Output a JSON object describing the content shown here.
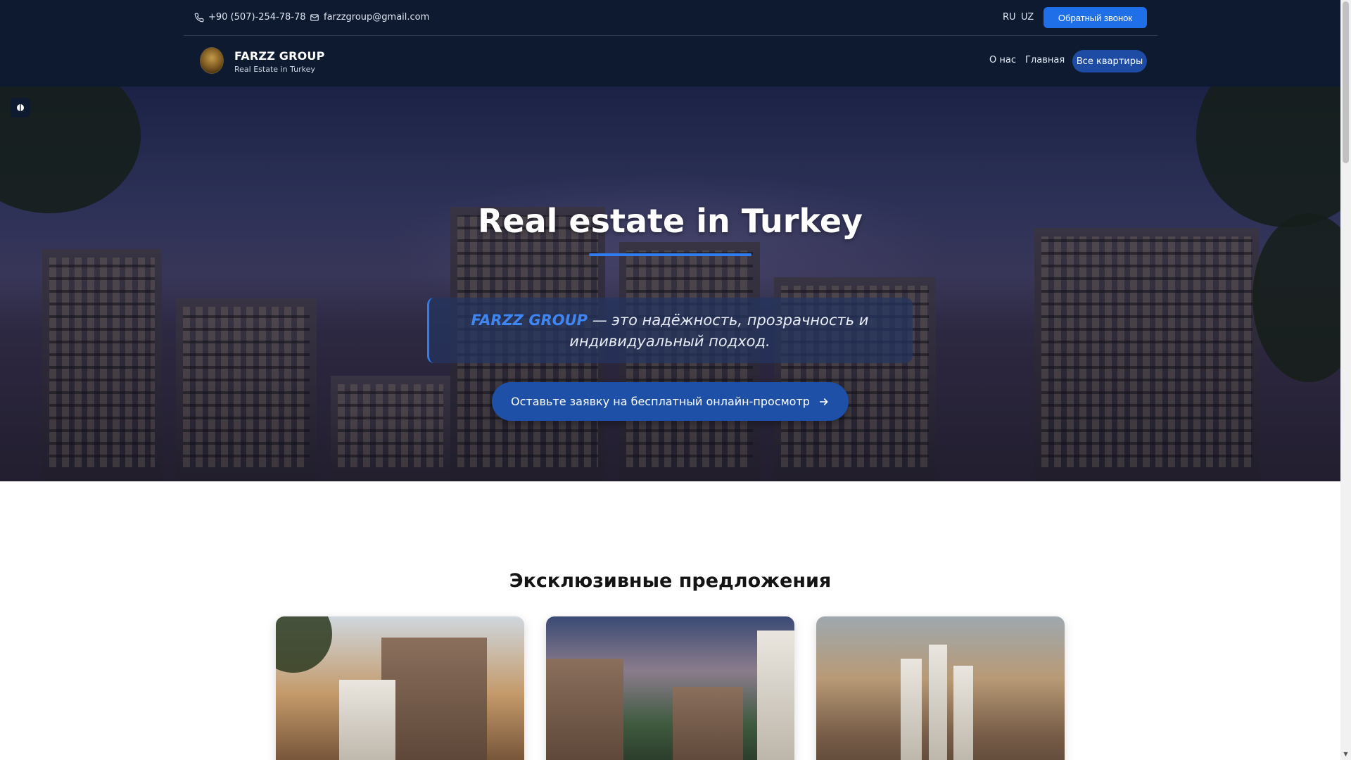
{
  "topbar": {
    "phone": "+90 (507)-254-78-78",
    "email": "farzzgroup@gmail.com",
    "lang_ru": "RU",
    "lang_uz": "UZ",
    "callback_label": "Обратный звонок"
  },
  "brand": {
    "name": "FARZZ GROUP",
    "tagline": "Real Estate in Turkey"
  },
  "nav": {
    "about": "О нас",
    "home": "Главная",
    "all_apartments": "Все квартиры"
  },
  "hero": {
    "title": "Real estate in Turkey",
    "quote_brand": "FARZZ GROUP",
    "quote_rest": " — это надёжность, прозрачность и индивидуальный подход.",
    "cta_label": "Оставьте заявку на бесплатный онлайн-просмотр"
  },
  "offers": {
    "title": "Эксклюзивные предложения"
  },
  "colors": {
    "header_bg": "#0e1a30",
    "accent": "#1f6fe8",
    "nav_pill": "#1e4ba3",
    "cta": "#1e50a8"
  },
  "icons": {
    "phone": "phone-icon",
    "email": "mail-icon",
    "arrow": "arrow-right-icon",
    "toggle": "theme-toggle-icon"
  }
}
